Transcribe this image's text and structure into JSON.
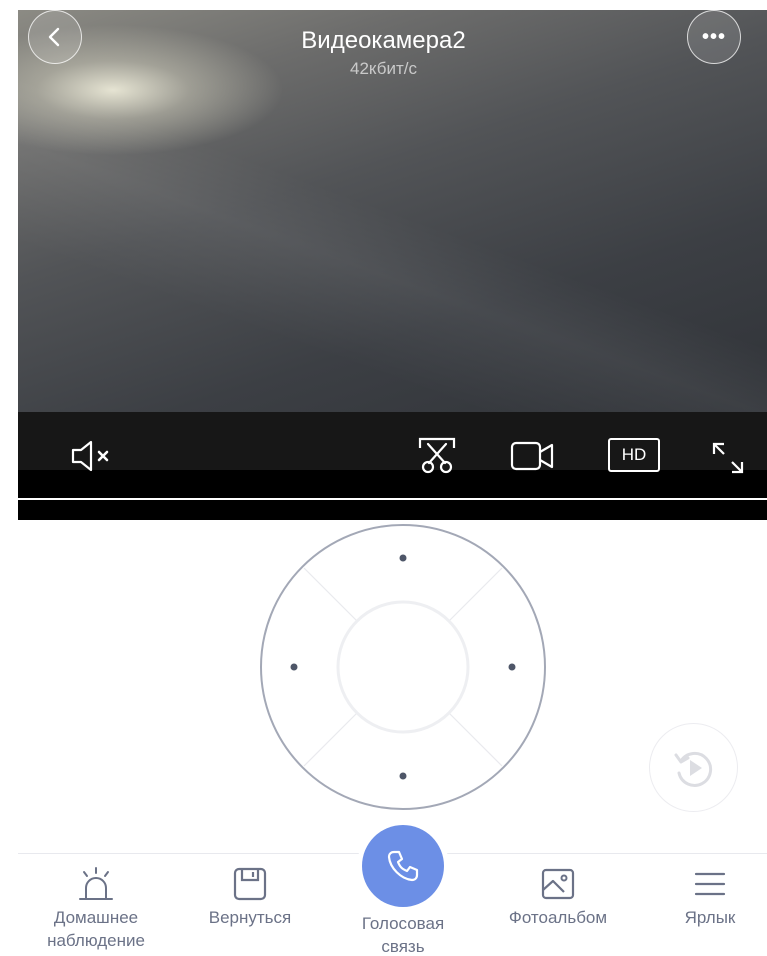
{
  "camera": {
    "title": "Видеокамера2",
    "bitrate": "42кбит/с"
  },
  "video_controls": {
    "mute_icon": "speaker-muted-icon",
    "screenshot_icon": "scissors-screenshot-icon",
    "record_icon": "video-camera-icon",
    "quality_label": "HD",
    "fullscreen_icon": "expand-icon"
  },
  "top_bar": {
    "back_icon": "chevron-left-icon",
    "more_icon": "more-dots-icon",
    "more_glyph": "•••"
  },
  "ptz": {
    "directions": [
      "up",
      "right",
      "down",
      "left"
    ]
  },
  "replay": {
    "icon": "playback-icon"
  },
  "bottom_nav": {
    "items": [
      {
        "label_line1": "Домашнее",
        "label_line2": "наблюдение",
        "icon": "alarm-light-icon"
      },
      {
        "label_line1": "Вернуться",
        "label_line2": "",
        "icon": "floppy-disk-icon"
      },
      {
        "label_line1": "Голосовая",
        "label_line2": "связь",
        "icon": "phone-icon"
      },
      {
        "label_line1": "Фотоальбом",
        "label_line2": "",
        "icon": "photo-album-icon"
      },
      {
        "label_line1": "Ярлык",
        "label_line2": "",
        "icon": "menu-icon"
      }
    ]
  },
  "colors": {
    "accent": "#6c8fe6",
    "nav_text": "#6b7287",
    "ring": "#a3a8b6"
  }
}
